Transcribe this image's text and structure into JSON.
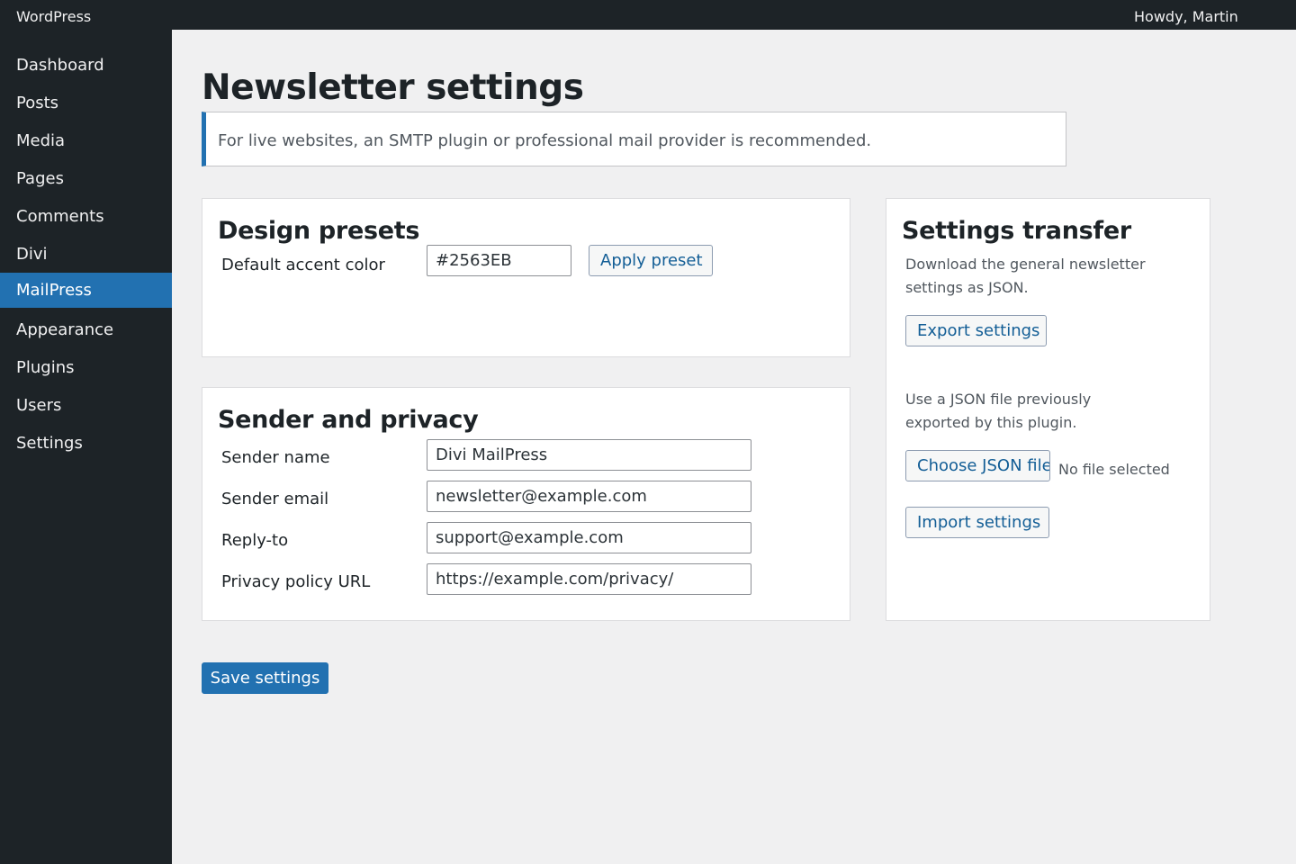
{
  "adminbar": {
    "site_name": "WordPress",
    "greeting": "Howdy, Martin"
  },
  "sidebar": {
    "items": [
      {
        "label": "Dashboard"
      },
      {
        "label": "Posts"
      },
      {
        "label": "Media"
      },
      {
        "label": "Pages"
      },
      {
        "label": "Comments"
      },
      {
        "label": "Divi"
      },
      {
        "label": "MailPress",
        "active": true
      },
      {
        "label": "Appearance"
      },
      {
        "label": "Plugins"
      },
      {
        "label": "Users"
      },
      {
        "label": "Settings"
      }
    ]
  },
  "page": {
    "title": "Newsletter settings",
    "notice": "For live websites, an SMTP plugin or professional mail provider is recommended."
  },
  "design_presets": {
    "title": "Design presets",
    "accent_label": "Default accent color",
    "accent_value": "#2563EB",
    "apply_label": "Apply preset"
  },
  "sender_privacy": {
    "title": "Sender and privacy",
    "fields": [
      {
        "label": "Sender name",
        "value": "Divi MailPress"
      },
      {
        "label": "Sender email",
        "value": "newsletter@example.com"
      },
      {
        "label": "Reply-to",
        "value": "support@example.com"
      },
      {
        "label": "Privacy policy URL",
        "value": "https://example.com/privacy/"
      }
    ]
  },
  "settings_transfer": {
    "title": "Settings transfer",
    "export_help_line1": "Download the general newsletter",
    "export_help_line2": "settings as JSON.",
    "export_label": "Export settings",
    "import_help_line1": "Use a JSON file previously",
    "import_help_line2": "exported by this plugin.",
    "choose_label": "Choose JSON file",
    "file_status": "No file selected",
    "import_label": "Import settings"
  },
  "footer": {
    "save_label": "Save settings"
  },
  "colors": {
    "accent": "#2271b1",
    "menu_bg": "#1d2327",
    "page_bg": "#f0f0f1"
  }
}
